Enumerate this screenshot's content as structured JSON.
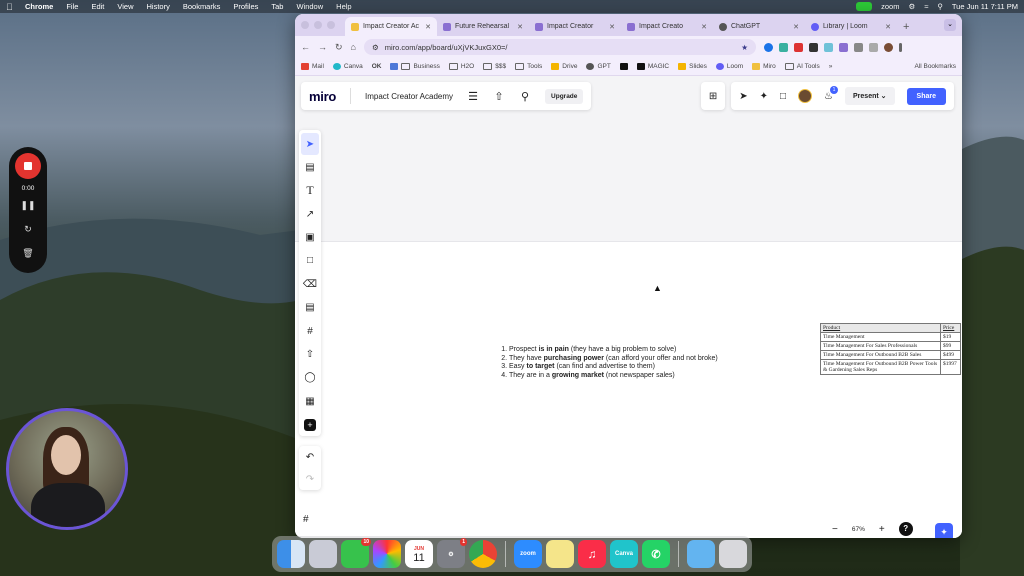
{
  "menubar": {
    "app": "Chrome",
    "items": [
      "File",
      "Edit",
      "View",
      "History",
      "Bookmarks",
      "Profiles",
      "Tab",
      "Window",
      "Help"
    ],
    "zoom_label": "zoom",
    "clock": "Tue Jun 11  7:11 PM"
  },
  "recorder": {
    "time": "0:00"
  },
  "browser": {
    "tabs": [
      {
        "title": "Impact Creator Ac",
        "active": true
      },
      {
        "title": "Future Rehearsal",
        "active": false
      },
      {
        "title": "Impact Creator",
        "active": false
      },
      {
        "title": "Impact Creato",
        "active": false
      },
      {
        "title": "ChatGPT",
        "active": false
      },
      {
        "title": "Library | Loom",
        "active": false
      }
    ],
    "url": "miro.com/app/board/uXjVKJuxGX0=/",
    "bookmarks": [
      "Mail",
      "Canva",
      "OK",
      "Business",
      "H2O",
      "$$$",
      "Tools",
      "Drive",
      "GPT",
      "MAGIC",
      "Slides",
      "Loom",
      "Miro",
      "AI Tools"
    ],
    "all_bookmarks": "All Bookmarks"
  },
  "miro": {
    "logo": "miro",
    "board_name": "Impact Creator Academy",
    "upgrade": "Upgrade",
    "present": "Present",
    "share": "Share",
    "notification_count": "1",
    "zoom_level": "67%",
    "help": "?",
    "notes": [
      {
        "pre": "Prospect ",
        "bold": "is in pain",
        "post": " (they have a big problem to solve)"
      },
      {
        "pre": "They have ",
        "bold": "purchasing power",
        "post": " (can afford your offer and not broke)"
      },
      {
        "pre": "Easy ",
        "bold": "to target",
        "post": " (can find and advertise to them)"
      },
      {
        "pre": "They are in a ",
        "bold": "growing market",
        "post": " (not newspaper sales)"
      }
    ],
    "price_table": {
      "headers": [
        "Product",
        "Price"
      ],
      "rows": [
        [
          "Time Management",
          "$19"
        ],
        [
          "Time Management For Sales Professionals",
          "$99"
        ],
        [
          "Time Management For Outbound B2B Sales",
          "$499"
        ],
        [
          "Time Management For Outbound B2B Power Tools & Gardening Sales Reps",
          "$1997"
        ]
      ]
    }
  },
  "dock": {
    "apps": [
      "Finder",
      "Launchpad",
      "Messages",
      "Photos",
      "Calendar",
      "System Settings",
      "Chrome",
      "Zoom",
      "Notes",
      "Music",
      "Canva",
      "WhatsApp",
      "Downloads",
      "Trash"
    ],
    "messages_badge": "10",
    "settings_badge": "1",
    "calendar_month": "JUN",
    "calendar_day": "11",
    "zoom_label": "zoom",
    "canva_label": "Canva"
  },
  "colors": {
    "miro_blue": "#4262ff",
    "tabbar": "#dcd3f0",
    "record_red": "#e3342f"
  }
}
